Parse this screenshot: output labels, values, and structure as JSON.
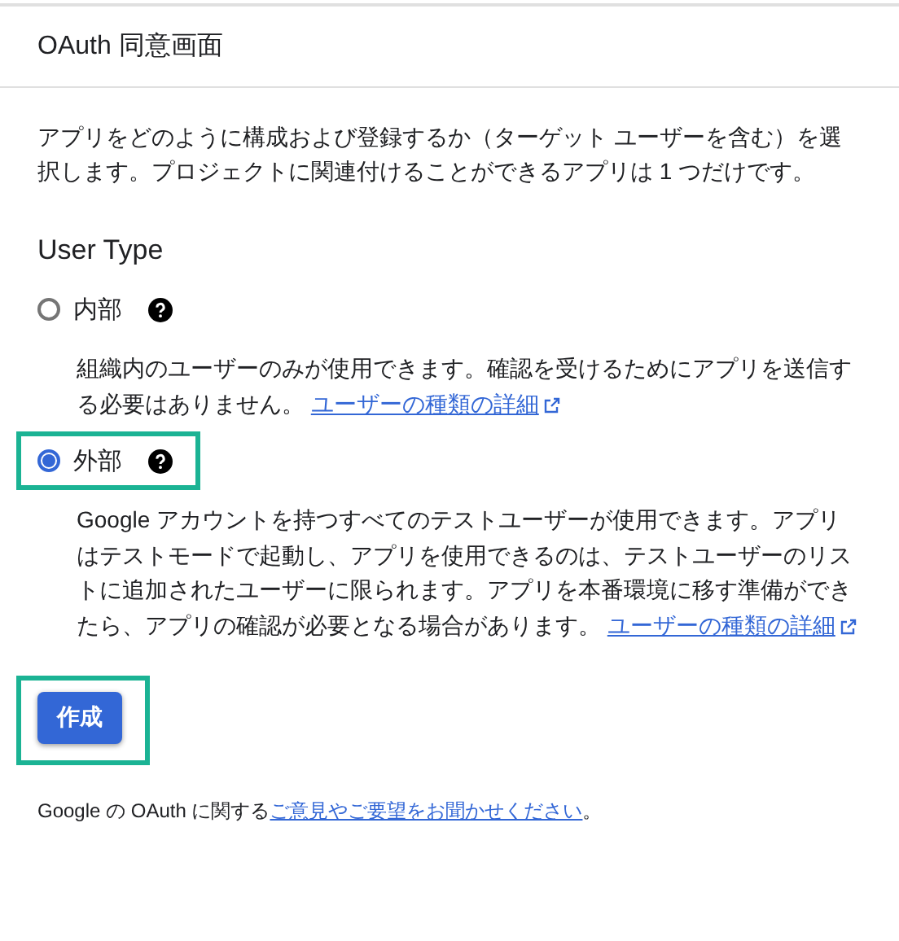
{
  "header": {
    "title": "OAuth 同意画面"
  },
  "intro": "アプリをどのように構成および登録するか（ターゲット ユーザーを含む）を選択します。プロジェクトに関連付けることができるアプリは 1 つだけです。",
  "user_type": {
    "label": "User Type",
    "options": [
      {
        "label": "内部",
        "selected": false,
        "highlighted": false,
        "description": "組織内のユーザーのみが使用できます。確認を受けるためにアプリを送信する必要はありません。",
        "link": "ユーザーの種類の詳細"
      },
      {
        "label": "外部",
        "selected": true,
        "highlighted": true,
        "description": "Google アカウントを持つすべてのテストユーザーが使用できます。アプリはテストモードで起動し、アプリを使用できるのは、テストユーザーのリストに追加されたユーザーに限られます。アプリを本番環境に移す準備ができたら、アプリの確認が必要となる場合があります。",
        "link": "ユーザーの種類の詳細"
      }
    ]
  },
  "create_button": {
    "label": "作成",
    "highlighted": true
  },
  "footer": {
    "text": "Google の OAuth に関する",
    "link": "ご意見やご要望をお聞かせください",
    "suffix": "。"
  }
}
